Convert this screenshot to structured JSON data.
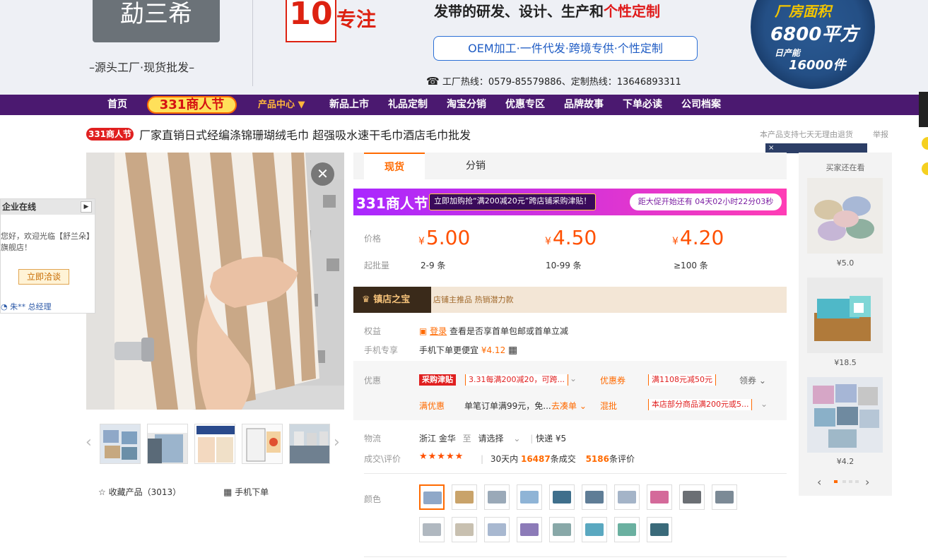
{
  "header": {
    "logo_text": "勐三希",
    "logo_tagline": "–源头工厂·现货批发–",
    "badge_number": "10",
    "badge_word": "专注",
    "headline_prefix": "发带的研发、设计、生产和",
    "headline_highlight": "个性定制",
    "oem_text": "OEM加工·一件代发·跨境专供·个性定制",
    "hotline_icon": "phone-icon",
    "hotline": "工厂热线：0579-85579886、定制热线：13646893311",
    "seal_line1": "厂房面积",
    "seal_line2": "6800平方",
    "seal_line3": "日产能",
    "seal_line4": "16000件"
  },
  "nav": {
    "items": [
      "首页",
      "新品上市",
      "礼品定制",
      "淘宝分销",
      "优惠专区",
      "品牌故事",
      "下单必读",
      "公司档案"
    ],
    "festival": "331商人节",
    "product_center": "产品中心 ▼"
  },
  "title_row": {
    "tag": "331商人节",
    "title": "厂家直销日式经编涤锦珊瑚绒毛巾 超强吸水速干毛巾酒店毛巾批发",
    "support": "本产品支持七天无理由退货",
    "report": "举报",
    "dark_strip_char": "×"
  },
  "float_panel": {
    "title": "企业在线",
    "greeting": "您好，欢迎光临【舒兰朵】旗舰店！",
    "button": "立即洽谈",
    "manager": "朱** 总经理"
  },
  "gallery": {
    "close_icon": "close-icon",
    "thumb_count_label": "",
    "favorite": "☆ 收藏产品（3013）",
    "mobile_order": "手机下单"
  },
  "tabs": [
    "现货",
    "分销"
  ],
  "festival_bar": {
    "logo": "331商人节",
    "promo": "立即加购抢“满200减20元”跨店铺采购津贴！",
    "countdown": "距大促开始还有 04天02小时22分03秒"
  },
  "pricing": {
    "price_label": "价格",
    "moq_label": "起批量",
    "prices": [
      "5.00",
      "4.50",
      "4.20"
    ],
    "currency": "¥",
    "quantities": [
      "2-9 条",
      "10-99 条",
      "≥100 条"
    ]
  },
  "treasure": {
    "title": "镇店之宝",
    "subtitle": "店铺主推品  热销潜力款"
  },
  "benefits": {
    "label": "权益",
    "login": "登录",
    "text": "查看是否享首单包邮或首单立减",
    "mobile_label": "手机专享",
    "mobile_text": "手机下单更便宜",
    "mobile_price": "¥4.12"
  },
  "promotions": {
    "label": "优惠",
    "subsidy_badge": "采购津贴",
    "subsidy_text": "3.31每满200减20，可跨...",
    "coupon_label": "优惠券",
    "coupon_text": "满1108元减50元",
    "get_coupon": "领券",
    "full_discount_label": "满优惠",
    "full_discount_text": "单笔订单满99元，免...",
    "go_bundle": "去凑单",
    "mixed_label": "混批",
    "mixed_text": "本店部分商品满200元或5..."
  },
  "logistics": {
    "label": "物流",
    "origin": "浙江 金华",
    "to": "至",
    "dest": "请选择",
    "express": "快递 ¥5",
    "deals_label": "成交\\评价",
    "stars": "★★★★★",
    "deals_prefix": "30天内",
    "deals_count": "16487",
    "deals_suffix": "条成交",
    "review_count": "5186",
    "review_suffix": "条评价"
  },
  "color_label": "颜色",
  "swatch_colors": [
    "#8fa8c8",
    "#c9a36a",
    "#9aa9b8",
    "#8fb4d6",
    "#3f6f8c",
    "#5f7d96",
    "#a4b4c8",
    "#d46a9a",
    "#6b6f74",
    "#7c8a96",
    "#b0b8c0",
    "#c8c0b0",
    "#a8b8d0",
    "#8c7bb8",
    "#88a8a8",
    "#5aa8c0",
    "#6ab0a0",
    "#3a6a7a"
  ],
  "recommend": {
    "title": "买家还在看",
    "prices": [
      "¥5.0",
      "¥18.5",
      "¥4.2"
    ]
  }
}
